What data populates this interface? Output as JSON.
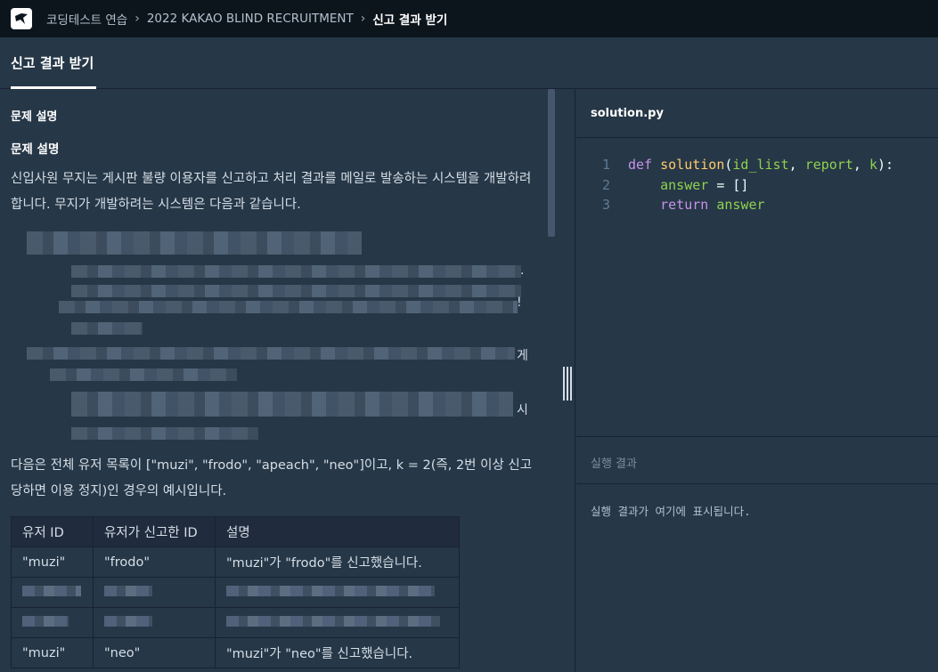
{
  "breadcrumb": {
    "items": [
      "코딩테스트 연습",
      "2022 KAKAO BLIND RECRUITMENT"
    ],
    "current": "신고 결과 받기"
  },
  "tab": {
    "label": "신고 결과 받기"
  },
  "problem": {
    "section_label": "문제 설명",
    "heading": "문제 설명",
    "intro": "신입사원 무지는 게시판 불량 이용자를 신고하고 처리 결과를 메일로 발송하는 시스템을 개발하려 합니다. 무지가 개발하려는 시스템은 다음과 같습니다.",
    "blur_tails": [
      ".",
      "!",
      "게",
      "시"
    ],
    "example_intro": "다음은 전체 유저 목록이 [\"muzi\", \"frodo\", \"apeach\", \"neo\"]이고, k = 2(즉, 2번 이상 신고당하면 이용 정지)인 경우의 예시입니다.",
    "table": {
      "headers": [
        "유저 ID",
        "유저가 신고한 ID",
        "설명"
      ],
      "rows": [
        [
          "\"muzi\"",
          "\"frodo\"",
          "\"muzi\"가 \"frodo\"를 신고했습니다."
        ],
        [
          "\"muzi\"",
          "\"neo\"",
          "\"muzi\"가 \"neo\"를 신고했습니다."
        ]
      ]
    }
  },
  "editor": {
    "file_name": "solution.py",
    "lines": [
      {
        "num": "1"
      },
      {
        "num": "2"
      },
      {
        "num": "3"
      }
    ],
    "code": {
      "def": "def",
      "fn": "solution",
      "p1": "id_list",
      "p2": "report",
      "p3": "k",
      "answer": "answer",
      "assign": " = []",
      "ret": "return"
    }
  },
  "result": {
    "title": "실행 결과",
    "placeholder": "실행 결과가 여기에 표시됩니다."
  }
}
